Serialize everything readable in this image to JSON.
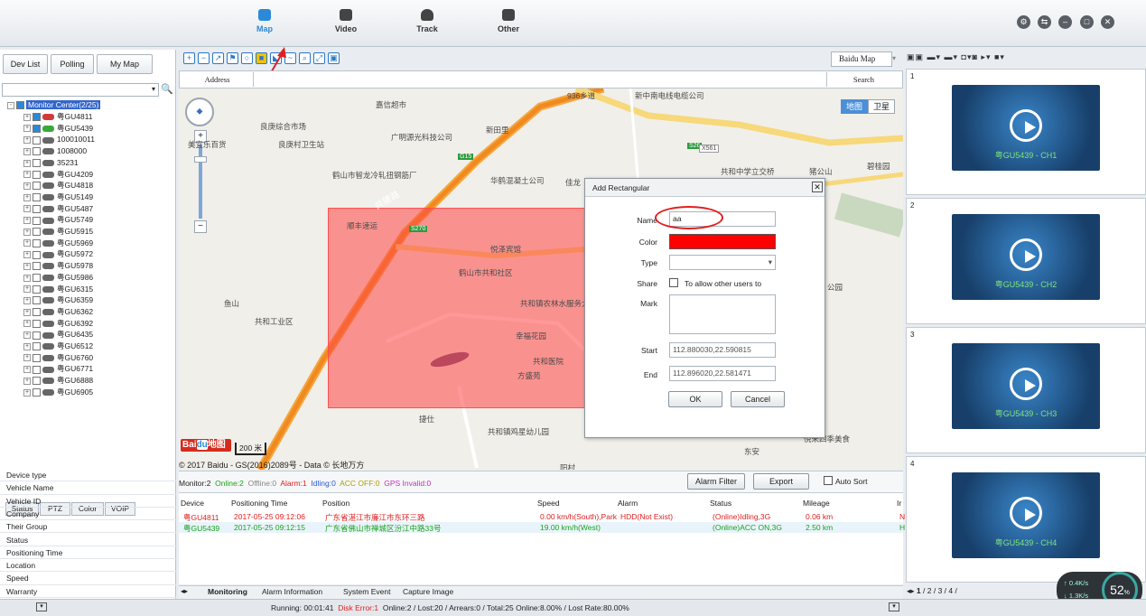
{
  "nav": {
    "items": [
      {
        "label": "Map"
      },
      {
        "label": "Video"
      },
      {
        "label": "Track"
      },
      {
        "label": "Other"
      }
    ]
  },
  "left": {
    "tabs": [
      "Dev List",
      "Polling",
      "My Map"
    ],
    "tree_root": "Monitor Center(2/25)",
    "devices": [
      "粤GU4811",
      "粤GU5439",
      "100010011",
      "1008000",
      "35231",
      "粤GU4209",
      "粤GU4818",
      "粤GU5149",
      "粤GU5487",
      "粤GU5749",
      "粤GU5915",
      "粤GU5969",
      "粤GU5972",
      "粤GU5978",
      "粤GU5986",
      "粤GU6315",
      "粤GU6359",
      "粤GU6362",
      "粤GU6392",
      "粤GU6435",
      "粤GU6512",
      "粤GU6760",
      "粤GU6771",
      "粤GU6888",
      "粤GU6905"
    ],
    "bottom_tabs": [
      "Status",
      "PTZ",
      "Color",
      "VOIP"
    ],
    "props": [
      "Device type",
      "Vehicle Name",
      "Vehicle ID",
      "Company",
      "Their Group",
      "Status",
      "Positioning Time",
      "Location",
      "Speed",
      "Warranty"
    ]
  },
  "map": {
    "provider": "Baidu Map",
    "address_label": "Address",
    "search_label": "Search",
    "map_type": [
      "地图",
      "卫星"
    ],
    "scale": "200 米",
    "copyright": "© 2017 Baidu - GS(2016)2089号 - Data © 长地万方",
    "labels": [
      "嘉信超市",
      "良庚综合市场",
      "广明源光科技公司",
      "新田里",
      "新中南电线电缆公司",
      "良庚村卫生站",
      "美宜乐百货",
      "鹤山市智龙冷轧扭钢筋厂",
      "华鹤混凝土公司",
      "佳龙",
      "共和中学立交桥",
      "猪公山",
      "碧桂园",
      "顺丰速运",
      "悦泽宾馆",
      "鹤山市共和社区",
      "共和镇农林水服务大楼",
      "幸福花园",
      "共和医院",
      "方盛苑",
      "共和工业区",
      "鱼山",
      "共和镇鸡星幼儿园",
      "公园",
      "东安",
      "悦来四季美食",
      "阳村",
      "共建路",
      "936乡道",
      "G15",
      "S270",
      "S26",
      "X561",
      "捷仕"
    ]
  },
  "dialog": {
    "title": "Add Rectangular",
    "name_label": "Name",
    "name_value": "aa",
    "color_label": "Color",
    "color_value": "#ff0000",
    "type_label": "Type",
    "type_value": "",
    "share_label": "Share",
    "share_text": "To allow other users to",
    "mark_label": "Mark",
    "mark_value": "",
    "start_label": "Start",
    "start_value": "112.880030,22.590815",
    "end_label": "End",
    "end_value": "112.896020,22.581471",
    "ok": "OK",
    "cancel": "Cancel"
  },
  "monitor": {
    "stats": {
      "monitor": "Monitor:2",
      "online": "Online:2",
      "offline": "Offline:0",
      "alarm": "Alarm:1",
      "idling": "Idling:0",
      "acc_off": "ACC OFF:0",
      "gps_invalid": "GPS Invalid:0"
    },
    "alarm_filter": "Alarm Filter",
    "export": "Export",
    "auto_sort": "Auto Sort",
    "headers": [
      "Device",
      "Positioning Time",
      "Position",
      "Speed",
      "Alarm",
      "Status",
      "Mileage",
      "Ir"
    ],
    "rows": [
      [
        "粤GU4811",
        "2017-05-25 09:12:06",
        "广东省湛江市廉江市东环三路",
        "0.00 km/h(South),Park",
        "HDD(Not Exist)",
        "(Online)Idling,3G",
        "0.06 km",
        "Ne"
      ],
      [
        "粤GU5439",
        "2017-05-25 09:12:15",
        "广东省佛山市禅城区汾江中路33号",
        "19.00 km/h(West)",
        "",
        "(Online)ACC ON,3G",
        "2.50 km",
        "HD"
      ]
    ],
    "tabs": [
      "Monitoring",
      "Alarm Information",
      "System Event",
      "Capture Image"
    ]
  },
  "video": {
    "cells": [
      {
        "num": "1",
        "cap": "粤GU5439 - CH1"
      },
      {
        "num": "2",
        "cap": "粤GU5439 - CH2"
      },
      {
        "num": "3",
        "cap": "粤GU5439 - CH3"
      },
      {
        "num": "4",
        "cap": "粤GU5439 - CH4"
      }
    ],
    "pages": [
      "1",
      "2",
      "3",
      "4"
    ],
    "net_up": "0.4K/s",
    "net_down": "1.3K/s",
    "cpu": "52"
  },
  "footer": {
    "running": "Running: 00:01:41",
    "disk_error": "Disk Error:1",
    "summary": "Online:2 / Lost:20 / Arrears:0 / Total:25   Online:8.00% / Lost Rate:80.00%"
  },
  "colors": {
    "accent": "#2a8ad8",
    "online": "#1aa31a",
    "alarm": "#e02020",
    "fence": "#ff6b6b"
  }
}
